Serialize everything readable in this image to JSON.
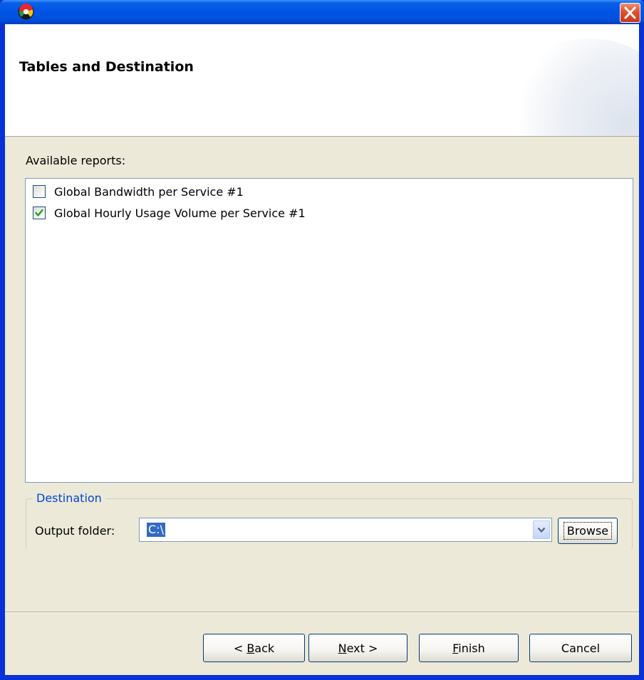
{
  "window": {
    "app_icon": "app-logo-icon",
    "close_icon": "close-icon",
    "colors": {
      "titlebar": "#0055e5",
      "close": "#e0502d",
      "frame": "#0831d9",
      "selection": "#316ac5",
      "legend": "#0046d5"
    }
  },
  "header": {
    "title": "Tables and Destination"
  },
  "reports": {
    "label": "Available reports:",
    "items": [
      {
        "label": "Global Bandwidth per Service #1",
        "checked": false
      },
      {
        "label": "Global Hourly Usage Volume per Service #1",
        "checked": true
      }
    ]
  },
  "destination": {
    "legend": "Destination",
    "output_label": "Output folder:",
    "output_value": "C:\\",
    "browse_label": "Browse",
    "dropdown_icon": "chevron-down-icon"
  },
  "buttons": {
    "back_prefix": "< ",
    "back_mnemonic": "B",
    "back_rest": "ack",
    "next_mnemonic": "N",
    "next_rest": "ext >",
    "finish_mnemonic": "F",
    "finish_rest": "inish",
    "cancel": "Cancel"
  }
}
